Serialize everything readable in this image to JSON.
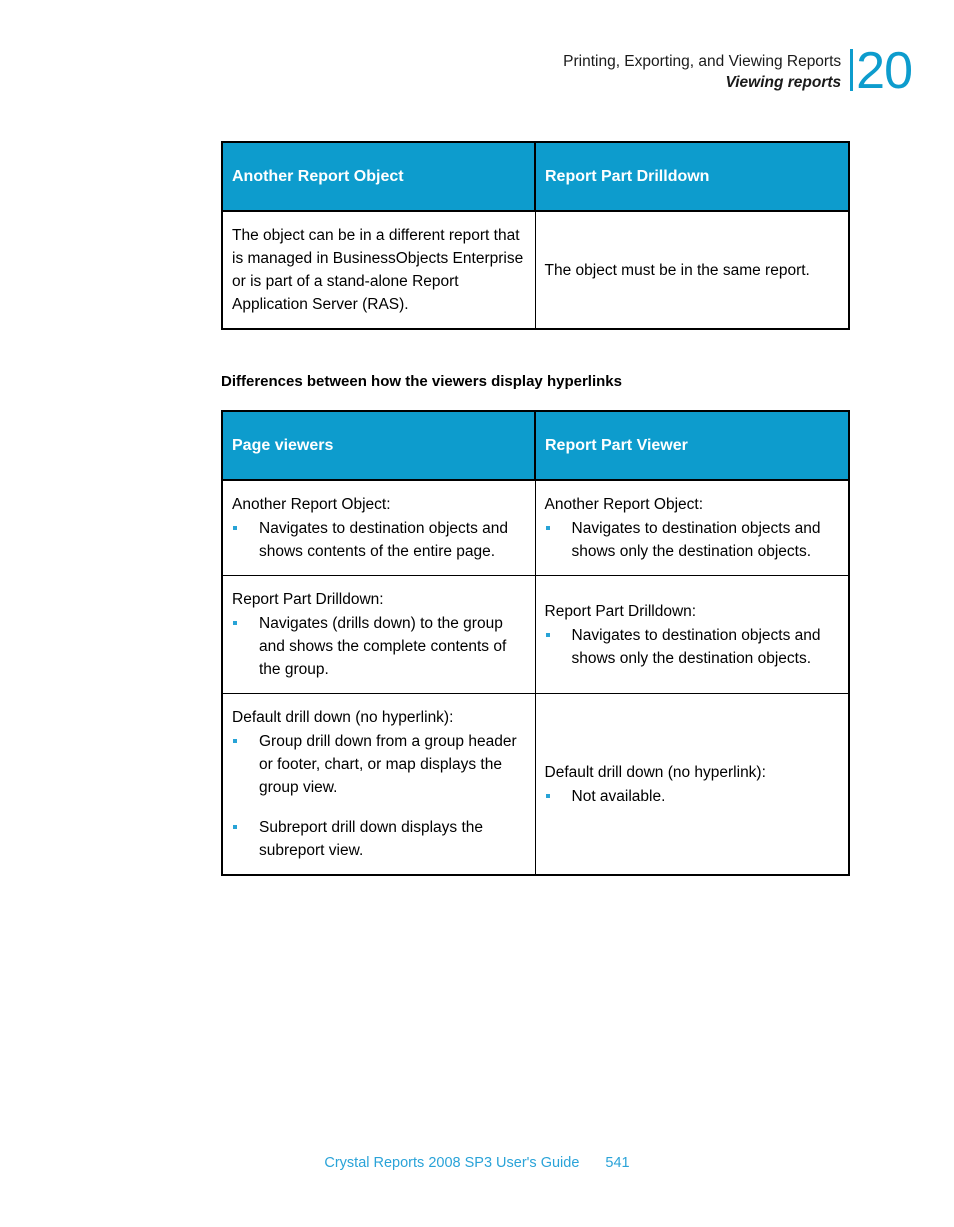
{
  "header": {
    "chapter_title": "Printing, Exporting, and Viewing Reports",
    "section_title": "Viewing reports",
    "chapter_number": "20"
  },
  "colors": {
    "accent": "#0d9ccd",
    "bullet": "#28a3d6",
    "footer_text": "#2aa3d8",
    "body_text": "#000000",
    "header_text": "#ffffff"
  },
  "table1": {
    "columns": [
      "Another Report Object",
      "Report Part Drilldown"
    ],
    "rows": [
      {
        "left": "The object can be in a different report that is managed in BusinessObjects Enterprise or is part of a stand-alone Report Application Server (RAS).",
        "right": "The object must be in the same report."
      }
    ]
  },
  "section_heading": "Differences between how the viewers display hyperlinks",
  "table2": {
    "columns": [
      "Page viewers",
      "Report Part Viewer"
    ],
    "rows": [
      {
        "left_lead": "Another Report Object:",
        "left_bullets": [
          "Navigates to destination objects and shows contents of the entire page."
        ],
        "right_lead": "Another Report Object:",
        "right_bullets": [
          "Navigates to destination objects and shows only the destination objects."
        ]
      },
      {
        "left_lead": "Report Part Drilldown:",
        "left_bullets": [
          "Navigates (drills down) to the group and shows the complete contents of the group."
        ],
        "right_lead": "Report Part Drilldown:",
        "right_bullets": [
          "Navigates to destination objects and shows only the destination objects."
        ]
      },
      {
        "left_lead": "Default drill down (no hyperlink):",
        "left_bullets": [
          "Group drill down from a group header or footer, chart, or map displays the group view.",
          "Subreport drill down displays the subreport view."
        ],
        "right_lead": "Default drill down (no hyperlink):",
        "right_bullets": [
          "Not available."
        ]
      }
    ]
  },
  "footer": {
    "title": "Crystal Reports 2008 SP3 User's Guide",
    "page_number": "541"
  }
}
